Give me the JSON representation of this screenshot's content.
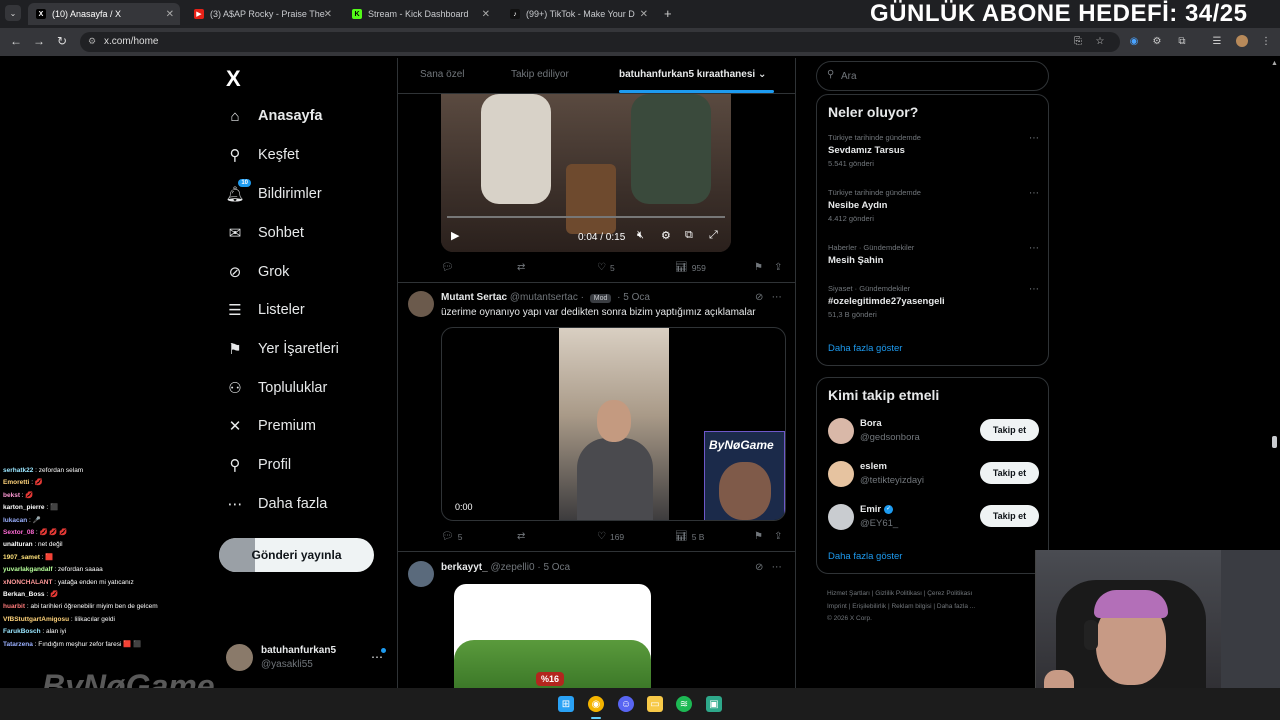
{
  "browser": {
    "tabs": [
      {
        "title": "(10) Anasayfa / X",
        "icon": "x-icon",
        "active": true
      },
      {
        "title": "(3) A$AP Rocky - Praise The",
        "icon": "youtube-icon",
        "active": false
      },
      {
        "title": "Stream - Kick Dashboard",
        "icon": "kick-icon",
        "active": false
      },
      {
        "title": "(99+) TikTok - Make Your D",
        "icon": "tiktok-icon",
        "active": false
      }
    ],
    "url": "x.com/home"
  },
  "stream_overlay": {
    "goal_text": "GÜNLÜK ABONE HEDEFİ: 34/25",
    "watermark": "ByNøGame",
    "chat": [
      {
        "user": "serhatk22",
        "msg": ": zefordan selam",
        "color": "#9ae6ff"
      },
      {
        "user": "Emoretti",
        "msg": ": 💋",
        "color": "#ffd37a"
      },
      {
        "user": "bekst",
        "msg": ": 💋",
        "color": "#ff9ad5"
      },
      {
        "user": "karton_pierre",
        "msg": ": ⬛",
        "color": "#ffffff"
      },
      {
        "user": "lukacan",
        "msg": ": 🎤",
        "color": "#9ab0ff"
      },
      {
        "user": "Sextor_08",
        "msg": ": 💋 💋 💋",
        "color": "#ff6ad5"
      },
      {
        "user": "unalturan",
        "msg": ": net değil",
        "color": "#ffffff"
      },
      {
        "user": "1907_samet",
        "msg": ": 🟥",
        "color": "#ffe27a"
      },
      {
        "user": "yuvarlakgandalf",
        "msg": ": zefordan saaaa",
        "color": "#b6ff9a"
      },
      {
        "user": "xNONCHALANT",
        "msg": ": yatağa enden mi yatıcanız",
        "color": "#ff9a9a"
      },
      {
        "user": "Berkan_Boss",
        "msg": ": 💋",
        "color": "#ffffff"
      },
      {
        "user": "huarbit",
        "msg": ": abi tarihleri öğrenebilir miyim ben de gelcem",
        "color": "#ff7a7a"
      },
      {
        "user": "VfBStuttgartAmigosu",
        "msg": ": lilikacılar geldi",
        "color": "#ffd37a"
      },
      {
        "user": "FarukBosch",
        "msg": ": alan iyi",
        "color": "#9ae6ff"
      },
      {
        "user": "Tatarzena",
        "msg": ": Fındığım meşhur zefor faresi 🟥 ⬛",
        "color": "#9ab0ff"
      }
    ]
  },
  "nav": {
    "logo": "X",
    "items": [
      {
        "label": "Anasayfa",
        "icon": "home-icon",
        "glyph": "⌂",
        "active": true
      },
      {
        "label": "Keşfet",
        "icon": "search-icon",
        "glyph": "⚲"
      },
      {
        "label": "Bildirimler",
        "icon": "bell-icon",
        "glyph": "🔔︎",
        "badge": "10"
      },
      {
        "label": "Sohbet",
        "icon": "mail-icon",
        "glyph": "✉"
      },
      {
        "label": "Grok",
        "icon": "grok-icon",
        "glyph": "⊘"
      },
      {
        "label": "Listeler",
        "icon": "list-icon",
        "glyph": "☰"
      },
      {
        "label": "Yer İşaretleri",
        "icon": "bookmark-icon",
        "glyph": "⚑"
      },
      {
        "label": "Topluluklar",
        "icon": "communities-icon",
        "glyph": "⚇"
      },
      {
        "label": "Premium",
        "icon": "x-premium-icon",
        "glyph": "✕"
      },
      {
        "label": "Profil",
        "icon": "profile-icon",
        "glyph": "⚲"
      },
      {
        "label": "Daha fazla",
        "icon": "more-circle-icon",
        "glyph": "⋯"
      }
    ],
    "post_button": "Gönderi yayınla",
    "account": {
      "name": "batuhanfurkan5",
      "handle": "@yasakli55"
    }
  },
  "feed": {
    "tabs": [
      "Sana özel",
      "Takip ediliyor",
      "batuhanfurkan5 kıraathanesi"
    ],
    "video1": {
      "time": "0:04 / 0:15",
      "replies": "",
      "retweets": "",
      "likes": "5",
      "views": "959"
    },
    "tweets": [
      {
        "name": "Mutant Sertac",
        "handle": "@mutantsertac",
        "mod_badge": "Mod",
        "date": "5 Oca",
        "text": "üzerime oynanıyo yapı var dedikten sonra bizim yaptığımız açıklamalar",
        "video_time": "0:00",
        "overlay_brand": "ByNøGame",
        "replies": "5",
        "retweets": "",
        "likes": "169",
        "views": "5 B"
      },
      {
        "name": "berkayyt_",
        "handle": "@zepelli0",
        "date": "5 Oca",
        "media_label": "%16"
      }
    ]
  },
  "sidebar": {
    "search_placeholder": "Ara",
    "trends_title": "Neler oluyor?",
    "trends": [
      {
        "context": "Türkiye tarihinde gündemde",
        "title": "Sevdamız Tarsus",
        "count": "5.541 gönderi"
      },
      {
        "context": "Türkiye tarihinde gündemde",
        "title": "Nesibe Aydın",
        "count": "4.412 gönderi"
      },
      {
        "context": "Haberler · Gündemdekiler",
        "title": "Mesih Şahin",
        "count": ""
      },
      {
        "context": "Siyaset · Gündemdekiler",
        "title": "#ozelegitimde27yasengeli",
        "count": "51,3 B gönderi"
      }
    ],
    "show_more": "Daha fazla göster",
    "who_title": "Kimi takip etmeli",
    "who": [
      {
        "name": "Bora",
        "handle": "@gedsonbora",
        "verified": false,
        "avatar_color": "#d9b8a8"
      },
      {
        "name": "eslem",
        "handle": "@tetikteyizdayi",
        "verified": false,
        "avatar_color": "#e6c3a0"
      },
      {
        "name": "Emir",
        "handle": "@EY61_",
        "verified": true,
        "avatar_color": "#c9ccd0"
      }
    ],
    "follow_label": "Takip et",
    "footer": [
      "Hizmet Şartları",
      "Gizlilik Politikası",
      "Çerez Politikası",
      "Imprint",
      "Erişilebilirlik",
      "Reklam bilgisi",
      "Daha fazla ...",
      "© 2026 X Corp."
    ]
  },
  "colors": {
    "accent": "#1d9bf0",
    "bg": "#000000",
    "border": "#2f3336",
    "muted": "#71767b"
  }
}
